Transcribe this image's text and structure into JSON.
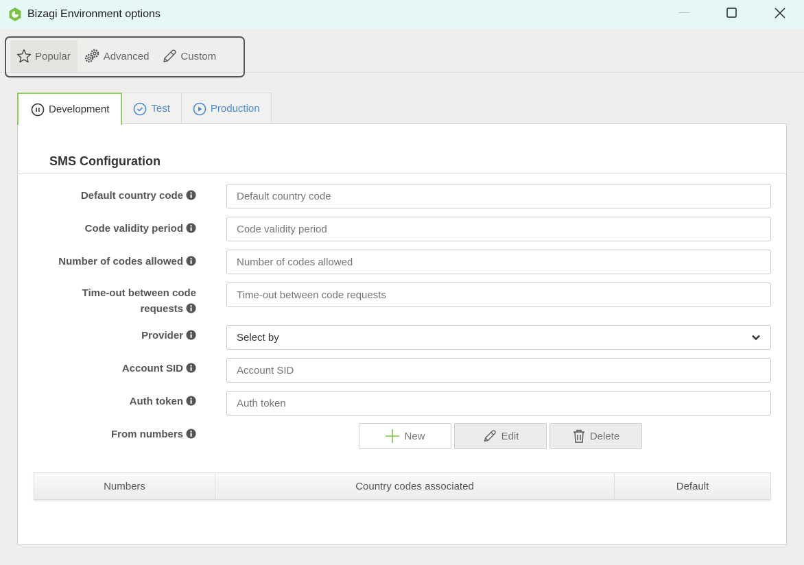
{
  "window": {
    "title": "Bizagi Environment options",
    "controls": [
      "minimize",
      "maximize",
      "close"
    ]
  },
  "toolbar": {
    "items": [
      {
        "label": "Popular",
        "icon": "star-icon",
        "active": true
      },
      {
        "label": "Advanced",
        "icon": "gears-icon",
        "active": false
      },
      {
        "label": "Custom",
        "icon": "pencil-icon",
        "active": false
      }
    ]
  },
  "tabs": [
    {
      "label": "Development",
      "icon": "pause-circle-icon",
      "active": true
    },
    {
      "label": "Test",
      "icon": "check-circle-icon",
      "active": false
    },
    {
      "label": "Production",
      "icon": "play-circle-icon",
      "active": false
    }
  ],
  "section": {
    "title": "SMS Configuration"
  },
  "form": {
    "fields": [
      {
        "label": "Default country code",
        "placeholder": "Default country code",
        "value": ""
      },
      {
        "label": "Code validity period",
        "placeholder": "Code validity period",
        "value": ""
      },
      {
        "label": "Number of codes allowed",
        "placeholder": "Number of codes allowed",
        "value": ""
      },
      {
        "label_line1": "Time-out between code",
        "label_line2": "requests",
        "placeholder": "Time-out between code requests",
        "value": ""
      },
      {
        "label": "Provider",
        "selected": "Select by"
      },
      {
        "label": "Account SID",
        "placeholder": "Account SID",
        "value": ""
      },
      {
        "label": "Auth token",
        "placeholder": "Auth token",
        "value": ""
      },
      {
        "label": "From numbers"
      }
    ]
  },
  "buttons": {
    "new": "New",
    "edit": "Edit",
    "delete": "Delete"
  },
  "grid": {
    "columns": [
      "Numbers",
      "Country codes associated",
      "Default"
    ],
    "rows": []
  },
  "colors": {
    "accent_green": "#8ecf5e",
    "tab_blue": "#4a8bd0",
    "titlebar_bg": "#e5f7f6"
  }
}
